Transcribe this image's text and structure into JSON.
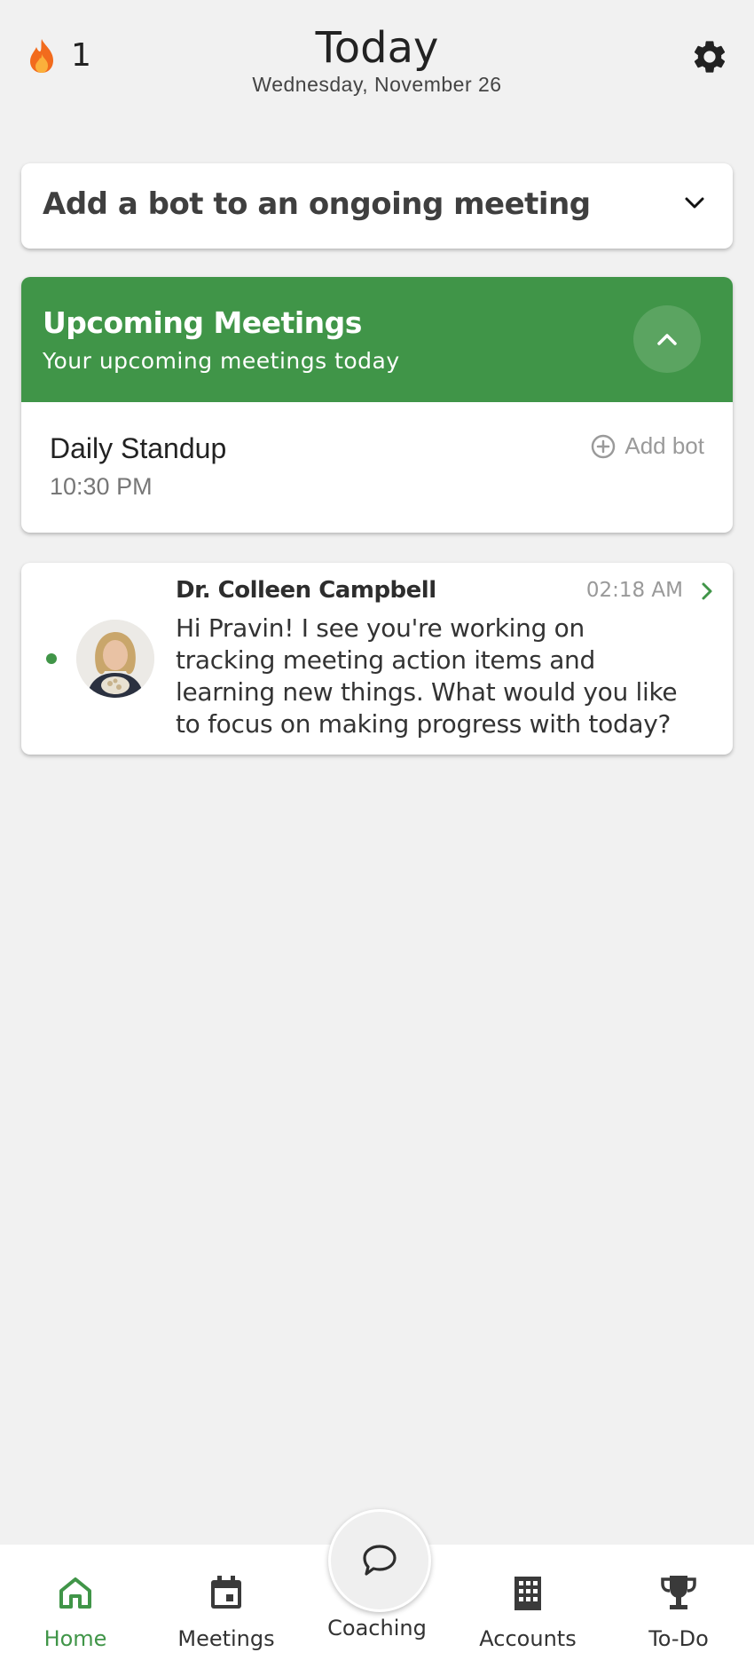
{
  "header": {
    "streak_count": "1",
    "title": "Today",
    "date": "Wednesday, November 26"
  },
  "add_bot_panel": {
    "label": "Add a bot to an ongoing meeting"
  },
  "upcoming": {
    "title": "Upcoming Meetings",
    "subtitle": "Your upcoming meetings today",
    "meetings": [
      {
        "name": "Daily Standup",
        "time": "10:30 PM",
        "action": "Add bot"
      }
    ]
  },
  "coach_message": {
    "name": "Dr. Colleen Campbell",
    "time": "02:18 AM",
    "text": "Hi Pravin! I see you're working on tracking meeting action items and learning new things. What would you like to focus on making progress with today?"
  },
  "nav": {
    "home": "Home",
    "meetings": "Meetings",
    "coaching": "Coaching",
    "accounts": "Accounts",
    "todo": "To-Do"
  },
  "colors": {
    "accent": "#409548",
    "background": "#f1f1f1"
  }
}
